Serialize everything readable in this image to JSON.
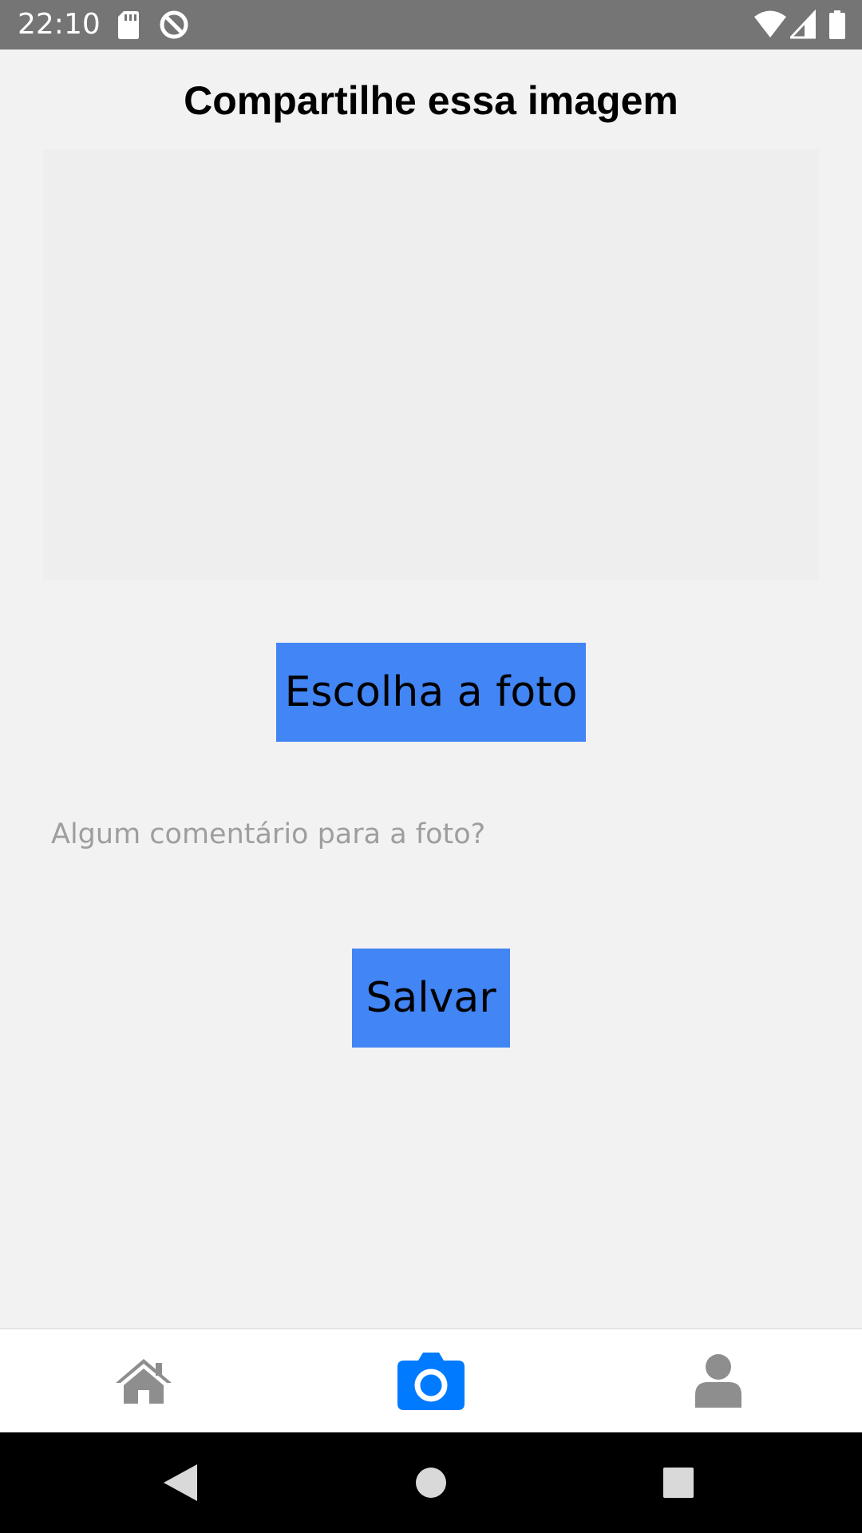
{
  "status_bar": {
    "time": "22:10",
    "icons": [
      "sd-card-icon",
      "do-not-disturb-icon",
      "wifi-icon",
      "cellular-signal-icon",
      "battery-icon"
    ]
  },
  "page": {
    "title": "Compartilhe essa imagem"
  },
  "choose_photo_button": {
    "label": "Escolha a foto"
  },
  "comment": {
    "placeholder": "Algum comentário para a foto?",
    "value": ""
  },
  "save_button": {
    "label": "Salvar"
  },
  "tab_bar": {
    "tabs": [
      {
        "icon": "home-icon",
        "active": false
      },
      {
        "icon": "camera-icon",
        "active": true
      },
      {
        "icon": "user-icon",
        "active": false
      }
    ],
    "active_color": "#007aff",
    "inactive_color": "#8e8e8e"
  },
  "nav_bar": {
    "buttons": [
      "back-icon",
      "home-circle-icon",
      "recents-icon"
    ]
  },
  "colors": {
    "button_background": "#4285f4",
    "status_bar_background": "#757575",
    "page_background": "#f2f2f2"
  }
}
